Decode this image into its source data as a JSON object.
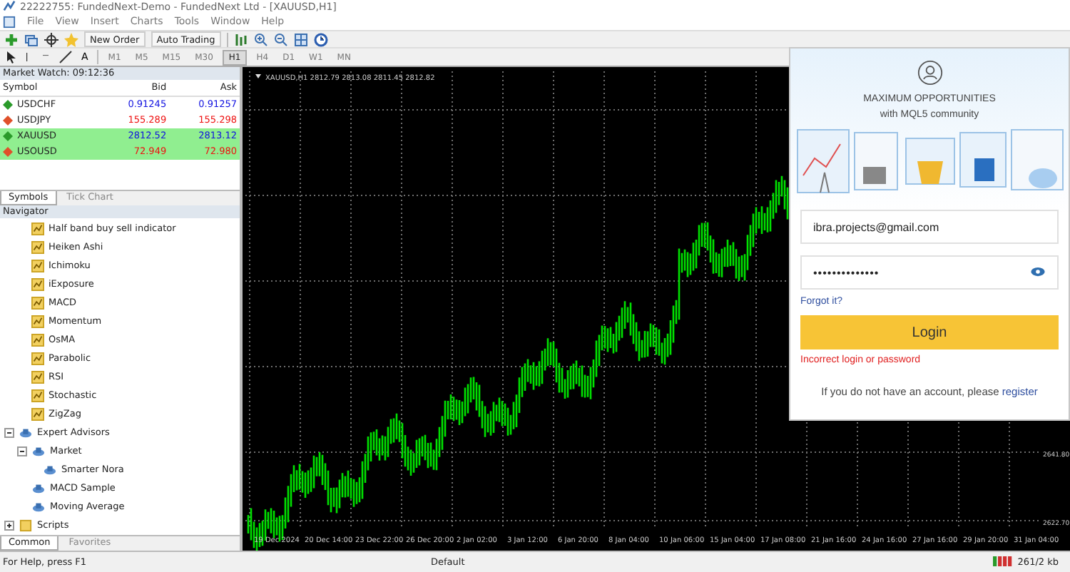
{
  "window": {
    "title": "22222755: FundedNext-Demo - FundedNext Ltd - [XAUUSD,H1]"
  },
  "menu": [
    "File",
    "View",
    "Insert",
    "Charts",
    "Tools",
    "Window",
    "Help"
  ],
  "toolbar": {
    "buttons": [
      {
        "label": "New Order"
      },
      {
        "label": "Auto Trading"
      }
    ]
  },
  "drawing_tools": {
    "text_tool": "A"
  },
  "timeframes": [
    {
      "label": "M1",
      "selected": false
    },
    {
      "label": "M5",
      "selected": false
    },
    {
      "label": "M15",
      "selected": false
    },
    {
      "label": "M30",
      "selected": false
    },
    {
      "label": "H1",
      "selected": true
    },
    {
      "label": "H4",
      "selected": false
    },
    {
      "label": "D1",
      "selected": false
    },
    {
      "label": "W1",
      "selected": false
    },
    {
      "label": "MN",
      "selected": false
    }
  ],
  "market_watch": {
    "title": "Market Watch: 09:12:36",
    "columns": [
      "Symbol",
      "Bid",
      "Ask"
    ],
    "rows": [
      {
        "symbol": "USDCHF",
        "kind": "up",
        "bid": "0.91245",
        "ask": "0.91257",
        "selected": false
      },
      {
        "symbol": "USDJPY",
        "kind": "down",
        "bid": "155.289",
        "ask": "155.298",
        "selected": false
      },
      {
        "symbol": "XAUUSD",
        "kind": "up",
        "bid": "2812.52",
        "ask": "2813.12",
        "selected": true
      },
      {
        "symbol": "USOUSD",
        "kind": "down",
        "bid": "72.949",
        "ask": "72.980",
        "selected": true
      }
    ],
    "tabs": [
      {
        "label": "Symbols",
        "selected": true
      },
      {
        "label": "Tick Chart",
        "selected": false
      }
    ]
  },
  "navigator": {
    "title": "Navigator",
    "indicator_items": [
      "Half band buy sell indicator",
      "Heiken Ashi",
      "Ichimoku",
      "iExposure",
      "MACD",
      "Momentum",
      "OsMA",
      "Parabolic",
      "RSI",
      "Stochastic",
      "ZigZag"
    ],
    "tree": [
      {
        "label": "Expert Advisors",
        "kind": "experts",
        "expanded": true,
        "children": [
          {
            "label": "Market",
            "kind": "experts",
            "expanded": true,
            "children": [
              {
                "label": "Smarter Nora",
                "kind": "experts"
              }
            ]
          },
          {
            "label": "MACD Sample",
            "kind": "experts"
          },
          {
            "label": "Moving Average",
            "kind": "experts"
          }
        ]
      },
      {
        "label": "Scripts",
        "kind": "scripts",
        "expanded": false
      }
    ],
    "tabs": [
      {
        "label": "Common",
        "selected": true
      },
      {
        "label": "Favorites",
        "selected": false
      }
    ]
  },
  "chart": {
    "header": "XAUUSD,H1  2812.79 2813.08 2811.45 2812.82",
    "price_labels": [
      "2641.80",
      "2622.70"
    ],
    "time_labels": [
      "19 Dec 2024",
      "20 Dec 14:00",
      "23 Dec 22:00",
      "26 Dec 20:00",
      "2 Jan 02:00",
      "3 Jan 12:00",
      "6 Jan 20:00",
      "8 Jan 04:00",
      "10 Jan 06:00",
      "15 Jan 04:00",
      "17 Jan 08:00",
      "21 Jan 16:00",
      "24 Jan 16:00",
      "27 Jan 16:00",
      "29 Jan 20:00",
      "31 Jan 04:00"
    ]
  },
  "login": {
    "heading": [
      "MAXIMUM OPPORTUNITIES",
      "with MQL5 community"
    ],
    "email": "ibra.projects@gmail.com",
    "password": "••••••••••••••",
    "forgot": "Forgot it?",
    "button": "Login",
    "error": "Incorrect login or password",
    "register_text": "If you do not have an account, please ",
    "register_link": "register"
  },
  "status_bar": {
    "help": "For Help, press F1",
    "profile": "Default",
    "traffic": "261/2 kb"
  }
}
